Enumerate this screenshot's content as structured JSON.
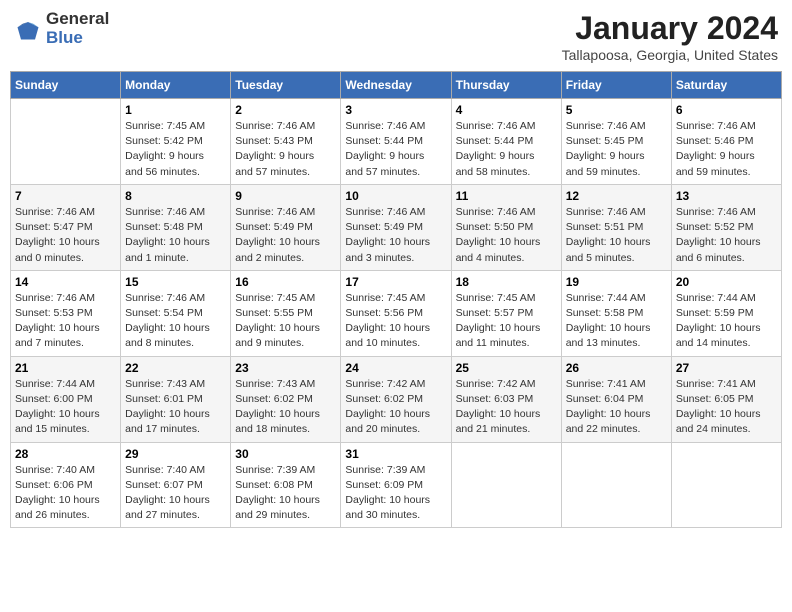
{
  "header": {
    "logo_general": "General",
    "logo_blue": "Blue",
    "month_year": "January 2024",
    "location": "Tallapoosa, Georgia, United States"
  },
  "days_of_week": [
    "Sunday",
    "Monday",
    "Tuesday",
    "Wednesday",
    "Thursday",
    "Friday",
    "Saturday"
  ],
  "weeks": [
    [
      {
        "day": "",
        "info": ""
      },
      {
        "day": "1",
        "info": "Sunrise: 7:45 AM\nSunset: 5:42 PM\nDaylight: 9 hours\nand 56 minutes."
      },
      {
        "day": "2",
        "info": "Sunrise: 7:46 AM\nSunset: 5:43 PM\nDaylight: 9 hours\nand 57 minutes."
      },
      {
        "day": "3",
        "info": "Sunrise: 7:46 AM\nSunset: 5:44 PM\nDaylight: 9 hours\nand 57 minutes."
      },
      {
        "day": "4",
        "info": "Sunrise: 7:46 AM\nSunset: 5:44 PM\nDaylight: 9 hours\nand 58 minutes."
      },
      {
        "day": "5",
        "info": "Sunrise: 7:46 AM\nSunset: 5:45 PM\nDaylight: 9 hours\nand 59 minutes."
      },
      {
        "day": "6",
        "info": "Sunrise: 7:46 AM\nSunset: 5:46 PM\nDaylight: 9 hours\nand 59 minutes."
      }
    ],
    [
      {
        "day": "7",
        "info": "Sunrise: 7:46 AM\nSunset: 5:47 PM\nDaylight: 10 hours\nand 0 minutes."
      },
      {
        "day": "8",
        "info": "Sunrise: 7:46 AM\nSunset: 5:48 PM\nDaylight: 10 hours\nand 1 minute."
      },
      {
        "day": "9",
        "info": "Sunrise: 7:46 AM\nSunset: 5:49 PM\nDaylight: 10 hours\nand 2 minutes."
      },
      {
        "day": "10",
        "info": "Sunrise: 7:46 AM\nSunset: 5:49 PM\nDaylight: 10 hours\nand 3 minutes."
      },
      {
        "day": "11",
        "info": "Sunrise: 7:46 AM\nSunset: 5:50 PM\nDaylight: 10 hours\nand 4 minutes."
      },
      {
        "day": "12",
        "info": "Sunrise: 7:46 AM\nSunset: 5:51 PM\nDaylight: 10 hours\nand 5 minutes."
      },
      {
        "day": "13",
        "info": "Sunrise: 7:46 AM\nSunset: 5:52 PM\nDaylight: 10 hours\nand 6 minutes."
      }
    ],
    [
      {
        "day": "14",
        "info": "Sunrise: 7:46 AM\nSunset: 5:53 PM\nDaylight: 10 hours\nand 7 minutes."
      },
      {
        "day": "15",
        "info": "Sunrise: 7:46 AM\nSunset: 5:54 PM\nDaylight: 10 hours\nand 8 minutes."
      },
      {
        "day": "16",
        "info": "Sunrise: 7:45 AM\nSunset: 5:55 PM\nDaylight: 10 hours\nand 9 minutes."
      },
      {
        "day": "17",
        "info": "Sunrise: 7:45 AM\nSunset: 5:56 PM\nDaylight: 10 hours\nand 10 minutes."
      },
      {
        "day": "18",
        "info": "Sunrise: 7:45 AM\nSunset: 5:57 PM\nDaylight: 10 hours\nand 11 minutes."
      },
      {
        "day": "19",
        "info": "Sunrise: 7:44 AM\nSunset: 5:58 PM\nDaylight: 10 hours\nand 13 minutes."
      },
      {
        "day": "20",
        "info": "Sunrise: 7:44 AM\nSunset: 5:59 PM\nDaylight: 10 hours\nand 14 minutes."
      }
    ],
    [
      {
        "day": "21",
        "info": "Sunrise: 7:44 AM\nSunset: 6:00 PM\nDaylight: 10 hours\nand 15 minutes."
      },
      {
        "day": "22",
        "info": "Sunrise: 7:43 AM\nSunset: 6:01 PM\nDaylight: 10 hours\nand 17 minutes."
      },
      {
        "day": "23",
        "info": "Sunrise: 7:43 AM\nSunset: 6:02 PM\nDaylight: 10 hours\nand 18 minutes."
      },
      {
        "day": "24",
        "info": "Sunrise: 7:42 AM\nSunset: 6:02 PM\nDaylight: 10 hours\nand 20 minutes."
      },
      {
        "day": "25",
        "info": "Sunrise: 7:42 AM\nSunset: 6:03 PM\nDaylight: 10 hours\nand 21 minutes."
      },
      {
        "day": "26",
        "info": "Sunrise: 7:41 AM\nSunset: 6:04 PM\nDaylight: 10 hours\nand 22 minutes."
      },
      {
        "day": "27",
        "info": "Sunrise: 7:41 AM\nSunset: 6:05 PM\nDaylight: 10 hours\nand 24 minutes."
      }
    ],
    [
      {
        "day": "28",
        "info": "Sunrise: 7:40 AM\nSunset: 6:06 PM\nDaylight: 10 hours\nand 26 minutes."
      },
      {
        "day": "29",
        "info": "Sunrise: 7:40 AM\nSunset: 6:07 PM\nDaylight: 10 hours\nand 27 minutes."
      },
      {
        "day": "30",
        "info": "Sunrise: 7:39 AM\nSunset: 6:08 PM\nDaylight: 10 hours\nand 29 minutes."
      },
      {
        "day": "31",
        "info": "Sunrise: 7:39 AM\nSunset: 6:09 PM\nDaylight: 10 hours\nand 30 minutes."
      },
      {
        "day": "",
        "info": ""
      },
      {
        "day": "",
        "info": ""
      },
      {
        "day": "",
        "info": ""
      }
    ]
  ]
}
